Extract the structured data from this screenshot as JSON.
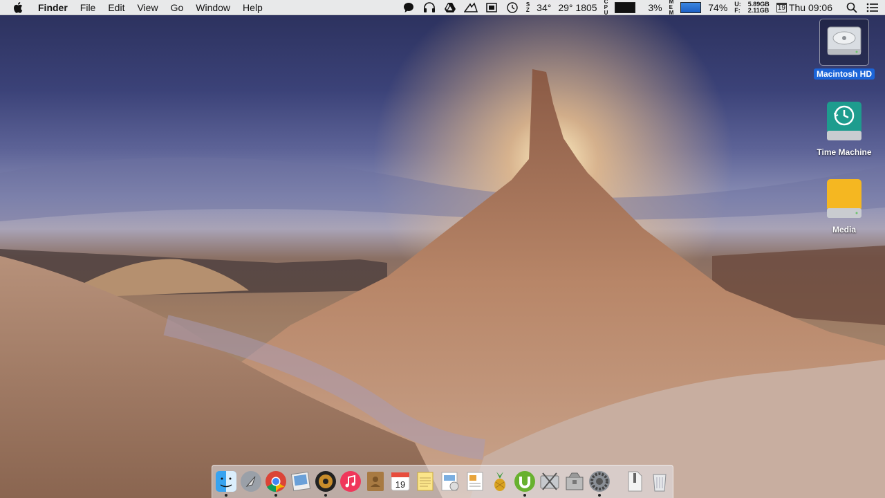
{
  "menubar": {
    "apple_icon": "apple-logo-icon",
    "app_name": "Finder",
    "menus": [
      "File",
      "Edit",
      "View",
      "Go",
      "Window",
      "Help"
    ],
    "status": {
      "temp": "34°",
      "fan": "29° 1805",
      "cpu_label": [
        "C",
        "P",
        "U"
      ],
      "cpu_percent": "3%",
      "mem_label": [
        "M",
        "E",
        "M"
      ],
      "mem_percent": "74%",
      "disk_u_label": "U:",
      "disk_f_label": "F:",
      "disk_used": "5.89GB",
      "disk_free": "2.11GB",
      "date_num": "19",
      "clock": "Thu 09:06",
      "icons": [
        "chat-bubble-icon",
        "headphones-icon",
        "google-drive-icon",
        "crane-icon",
        "memory-chip-icon",
        "time-machine-clock-icon",
        "spotlight-search-icon",
        "notification-list-icon"
      ]
    }
  },
  "desktop": {
    "icons": [
      {
        "label": "Macintosh HD",
        "icon": "hard-drive-icon",
        "selected": true
      },
      {
        "label": "Time Machine",
        "icon": "time-machine-drive-icon",
        "selected": false
      },
      {
        "label": "Media",
        "icon": "external-drive-icon",
        "selected": false
      }
    ]
  },
  "dock": {
    "items": [
      "finder-icon",
      "launchpad-icon",
      "chrome-icon",
      "preview-icon",
      "speaker-app-icon",
      "itunes-icon",
      "contacts-icon",
      "calendar-icon",
      "notes-icon",
      "textedit-icon",
      "pages-icon",
      "pineapple-app-icon",
      "utorrent-icon",
      "disk-utility-icon",
      "archive-utility-icon",
      "system-preferences-icon",
      "zip-file-icon",
      "trash-icon"
    ],
    "calendar_day": "19",
    "colors": {
      "accent": "#1b64d8"
    }
  }
}
